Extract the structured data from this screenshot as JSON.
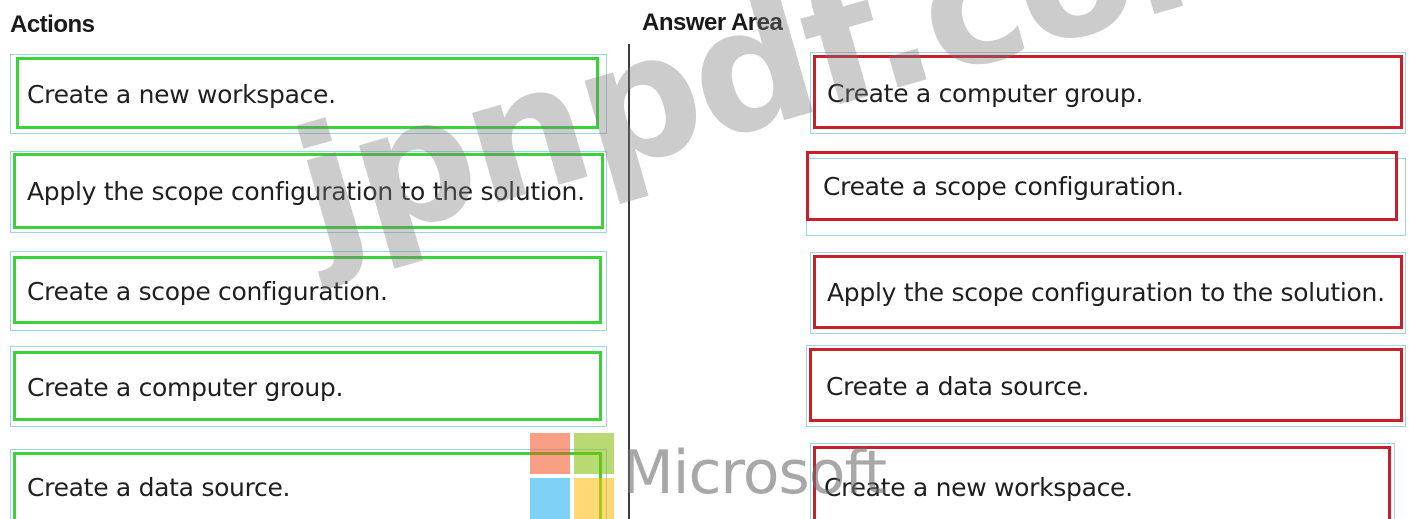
{
  "headings": {
    "actions": "Actions",
    "answer_area": "Answer Area"
  },
  "actions": [
    {
      "label": "Create a new workspace."
    },
    {
      "label": "Apply the scope configuration to the solution."
    },
    {
      "label": "Create a scope configuration."
    },
    {
      "label": "Create a computer group."
    },
    {
      "label": "Create a data source."
    }
  ],
  "answer_area": [
    {
      "label": "Create a computer group."
    },
    {
      "label": "Create a scope configuration."
    },
    {
      "label": "Apply the scope configuration to the solution."
    },
    {
      "label": "Create a data source."
    },
    {
      "label": "Create a new workspace."
    }
  ],
  "watermark": {
    "text": "jpnpdf.com",
    "brand": "Microsoft",
    "logo": "microsoft-logo"
  },
  "colors": {
    "action_border": "#3ad43a",
    "answer_border": "#c8202a",
    "box_outline": "#9fd3e6"
  }
}
